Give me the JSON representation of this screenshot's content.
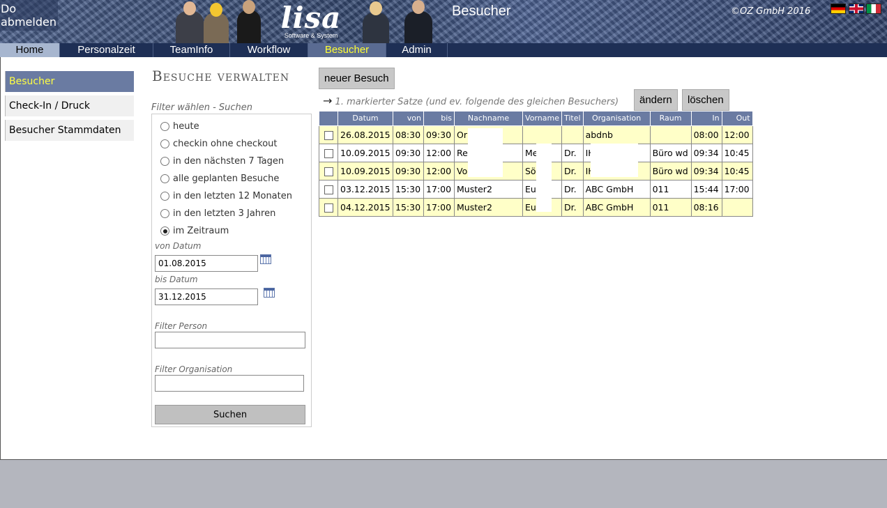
{
  "header": {
    "user_day": "Do",
    "logout": "abmelden",
    "logo_text": "lisa",
    "logo_sub": "Software & System",
    "page_heading": "Besucher",
    "copyright": "©OZ GmbH 2016",
    "flags": [
      "flag-de-icon",
      "flag-uk-icon",
      "flag-it-icon"
    ]
  },
  "nav": {
    "items": [
      "Home",
      "Personalzeit",
      "TeamInfo",
      "Workflow",
      "Besucher",
      "Admin"
    ],
    "active": "Besucher"
  },
  "sidebar": {
    "items": [
      "Besucher",
      "Check-In / Druck",
      "Besucher Stammdaten"
    ],
    "active": "Besucher"
  },
  "filter": {
    "title": "Besuche verwalten",
    "caption": "Filter wählen - Suchen",
    "options": [
      "heute",
      "checkin ohne checkout",
      "in den nächsten 7 Tagen",
      "alle geplanten Besuche",
      "in den letzten 12 Monaten",
      "in den letzten 3 Jahren",
      "im Zeitraum"
    ],
    "selected": "im Zeitraum",
    "from_label": "von Datum",
    "from_value": "01.08.2015",
    "to_label": "bis Datum",
    "to_value": "31.12.2015",
    "person_label": "Filter Person",
    "person_value": "",
    "org_label": "Filter Organisation",
    "org_value": "",
    "search_button": "Suchen"
  },
  "actions": {
    "new_visit": "neuer Besuch",
    "hint_arrow": "→",
    "hint": "1. markierter Satze (und ev. folgende des gleichen Besuchers)",
    "edit": "ändern",
    "delete": "löschen"
  },
  "table": {
    "columns": [
      "",
      "Datum",
      "von",
      "bis",
      "Nachname",
      "Vorname",
      "Titel",
      "Organisation",
      "Raum",
      "In",
      "Out"
    ],
    "rows": [
      {
        "datum": "26.08.2015",
        "von": "08:30",
        "bis": "09:30",
        "nachname": "Or          date",
        "vorname": "",
        "titel": "",
        "organisation": "abdnb",
        "raum": "",
        "in": "08:00",
        "out": "12:00"
      },
      {
        "datum": "10.09.2015",
        "von": "09:30",
        "bis": "12:00",
        "nachname": "Re",
        "vorname": "Me     ie",
        "titel": "Dr.",
        "organisation": "IH                ee",
        "raum": "Büro wd",
        "in": "09:34",
        "out": "10:45"
      },
      {
        "datum": "10.09.2015",
        "von": "09:30",
        "bis": "12:00",
        "nachname": "Vo",
        "vorname": "Sö     e",
        "titel": "Dr.",
        "organisation": "IH                ee",
        "raum": "Büro wd",
        "in": "09:34",
        "out": "10:45"
      },
      {
        "datum": "03.12.2015",
        "von": "15:30",
        "bis": "17:00",
        "nachname": "Muster2",
        "vorname": "Eu     n",
        "titel": "Dr.",
        "organisation": "ABC GmbH",
        "raum": "011",
        "in": "15:44",
        "out": "17:00"
      },
      {
        "datum": "04.12.2015",
        "von": "15:30",
        "bis": "17:00",
        "nachname": "Muster2",
        "vorname": "Eu     n",
        "titel": "Dr.",
        "organisation": "ABC GmbH",
        "raum": "011",
        "in": "08:16",
        "out": ""
      }
    ]
  },
  "colors": {
    "header_bg": "#3c5075",
    "nav_bg": "#1e2f55",
    "active_accent": "#ffff33",
    "table_header": "#6a7ba2",
    "row_highlight": "#ffffc8"
  }
}
